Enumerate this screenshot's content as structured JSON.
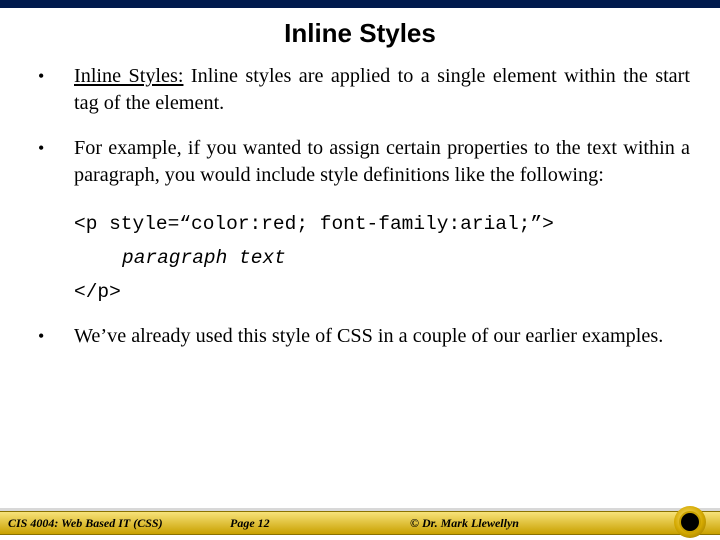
{
  "title": "Inline Styles",
  "bullets": {
    "b1_lead": "Inline Styles:",
    "b1_rest": " Inline styles are applied to a single element within the start tag of the element.",
    "b2": "For example, if you wanted to assign certain properties to the text within a paragraph, you would include style definitions like the following:",
    "b3": "We’ve already used this style of CSS in a couple of our earlier examples."
  },
  "code": {
    "line1": "<p style=“color:red; font-family:arial;”>",
    "line2": "paragraph text",
    "line3": "</p>"
  },
  "footer": {
    "left": "CIS 4004: Web Based IT (CSS)",
    "center": "Page 12",
    "right": "© Dr. Mark Llewellyn"
  }
}
